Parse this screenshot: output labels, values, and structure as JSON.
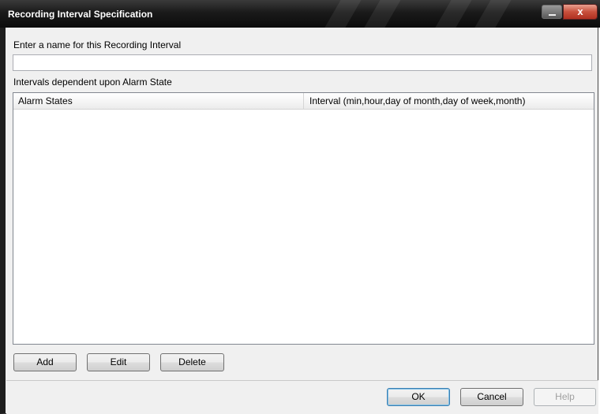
{
  "window": {
    "title": "Recording Interval Specification",
    "close_glyph": "x"
  },
  "form": {
    "name_label": "Enter a name for this Recording Interval",
    "name_value": "",
    "intervals_label": "Intervals dependent upon Alarm State"
  },
  "table": {
    "columns": [
      "Alarm States",
      "Interval (min,hour,day of month,day of week,month)"
    ],
    "rows": []
  },
  "actions": {
    "add": "Add",
    "edit": "Edit",
    "delete": "Delete"
  },
  "footer": {
    "ok": "OK",
    "cancel": "Cancel",
    "help": "Help"
  },
  "colors": {
    "titlebar": "#1a1a1a",
    "close_button": "#c8503c",
    "default_button_border": "#3c7fb1"
  }
}
